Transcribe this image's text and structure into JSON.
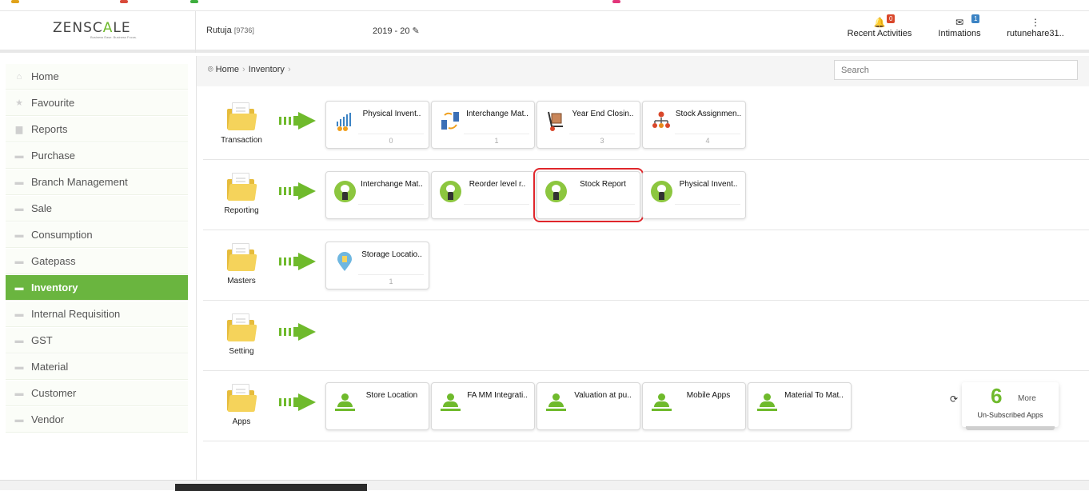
{
  "brand": {
    "logo_prefix": "ZENSC",
    "logo_mid": "A",
    "logo_suffix": "LE",
    "tagline": "Business Ease. Business Focus."
  },
  "header": {
    "user_name": "Rutuja",
    "user_id": "[9736]",
    "fiscal_year": "2019 - 20",
    "edit_icon": "✎",
    "recent_label": "Recent Activities",
    "recent_count": "0",
    "intimations_label": "Intimations",
    "intimations_count": "1",
    "account_label": "rutunehare31..",
    "bell_icon": "🔔",
    "mail_icon": "✉",
    "kebab_icon": "⋮"
  },
  "sidebar": {
    "items": [
      {
        "label": "Home",
        "icon": "⌂"
      },
      {
        "label": "Favourite",
        "icon": "★"
      },
      {
        "label": "Reports",
        "icon": "▆"
      },
      {
        "label": "Purchase",
        "icon": "▬"
      },
      {
        "label": "Branch Management",
        "icon": "▬"
      },
      {
        "label": "Sale",
        "icon": "▬"
      },
      {
        "label": "Consumption",
        "icon": "▬"
      },
      {
        "label": "Gatepass",
        "icon": "▬"
      },
      {
        "label": "Inventory",
        "icon": "▬"
      },
      {
        "label": "Internal Requisition",
        "icon": "▬"
      },
      {
        "label": "GST",
        "icon": "▬"
      },
      {
        "label": "Material",
        "icon": "▬"
      },
      {
        "label": "Customer",
        "icon": "▬"
      },
      {
        "label": "Vendor",
        "icon": "▬"
      }
    ],
    "active": "Inventory"
  },
  "breadcrumb": {
    "home": "Home",
    "current": "Inventory",
    "separator": "›",
    "home_icon": "⌾"
  },
  "search": {
    "placeholder": "Search"
  },
  "rows": {
    "transaction": {
      "label": "Transaction",
      "tiles": [
        {
          "title": "Physical Invent..",
          "count": "0"
        },
        {
          "title": "Interchange Mat..",
          "count": "1"
        },
        {
          "title": "Year End Closin..",
          "count": "3"
        },
        {
          "title": "Stock Assignmen..",
          "count": "4"
        }
      ]
    },
    "reporting": {
      "label": "Reporting",
      "tiles": [
        {
          "title": "Interchange Mat.."
        },
        {
          "title": "Reorder level r.."
        },
        {
          "title": "Stock Report"
        },
        {
          "title": "Physical Invent.."
        }
      ]
    },
    "masters": {
      "label": "Masters",
      "tiles": [
        {
          "title": "Storage Locatio..",
          "count": "1"
        }
      ]
    },
    "setting": {
      "label": "Setting"
    },
    "apps": {
      "label": "Apps",
      "tiles": [
        {
          "title": "Store Location"
        },
        {
          "title": "FA MM Integrati.."
        },
        {
          "title": "Valuation at pu.."
        },
        {
          "title": "Mobile Apps"
        },
        {
          "title": "Material To Mat.."
        }
      ]
    }
  },
  "more_apps": {
    "count": "6",
    "label": "More",
    "sub": "Un-Subscribed Apps",
    "refresh_icon": "⟳"
  },
  "colors": {
    "accent": "#6ab53f",
    "highlight": "#e0262b",
    "folder": "#f5d35b"
  }
}
